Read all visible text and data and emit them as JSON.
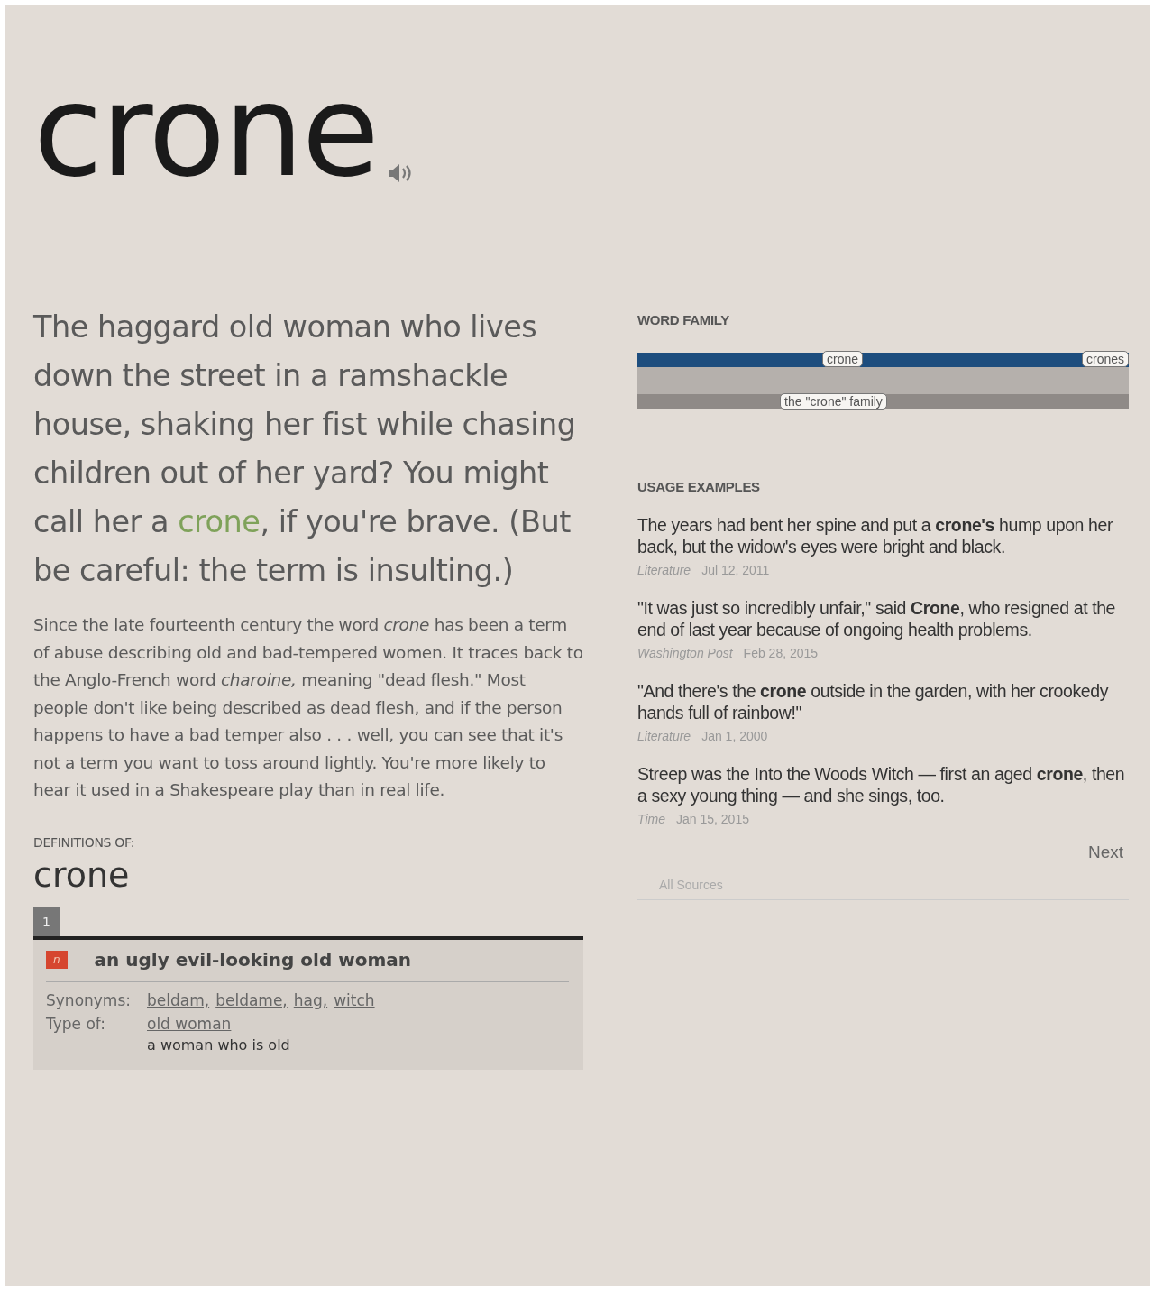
{
  "word": "crone",
  "lead": [
    {
      "text": "The haggard old woman who lives down the street in a ramshackle house, shaking her fist while chasing children out of her yard? You might call her a ",
      "highlight": false
    },
    {
      "text": "crone",
      "highlight": true
    },
    {
      "text": ", if you're brave. (But be careful: the term is insulting.)",
      "highlight": false
    }
  ],
  "long_description": "Since the late fourteenth century the word *crone* has been a term of abuse describing old and bad-tempered women. It traces back to the Anglo-French word *charoine,* meaning \"dead flesh.\" Most people don't like being described as dead flesh, and if the person happens to have a bad temper also . . . well, you can see that it's not a term you want to toss around lightly. You're more likely to hear it used in a Shakespeare play than in real life.",
  "definitions": {
    "heading": "DEFINITIONS OF:",
    "word": "crone",
    "senses": [
      {
        "number": "1",
        "part_of_speech": "n",
        "definition": "an ugly evil-looking old woman",
        "synonyms_label": "Synonyms:",
        "synonyms": [
          "beldam,",
          "beldame,",
          "hag,",
          "witch"
        ],
        "type_of_label": "Type of:",
        "type_of": "old woman",
        "type_of_definition": "a woman who is old"
      }
    ]
  },
  "word_family": {
    "heading": "WORD FAMILY",
    "words": [
      "crone",
      "crones"
    ],
    "family": "the \"crone\" family"
  },
  "usage_examples": {
    "heading": "USAGE EXAMPLES",
    "items": [
      {
        "text": "The years had bent her spine and put a **crone's** hump upon her back, but the widow's eyes were bright and black.",
        "source": "Literature",
        "date": "Jul 12, 2011"
      },
      {
        "text": "\"It was just so incredibly unfair,\" said **Crone**, who resigned at the end of last year because of ongoing health problems.",
        "source": "Washington Post",
        "date": "Feb 28, 2015"
      },
      {
        "text": "\"And there's the **crone** outside in the garden, with her crookedy hands full of rainbow!\"",
        "source": "Literature",
        "date": "Jan 1, 2000"
      },
      {
        "text": "Streep was the Into the Woods Witch — first an aged **crone**, then a sexy young thing — and she sings, too.",
        "source": "Time",
        "date": "Jan 15, 2015"
      }
    ],
    "next": "Next",
    "filter": "All Sources"
  }
}
